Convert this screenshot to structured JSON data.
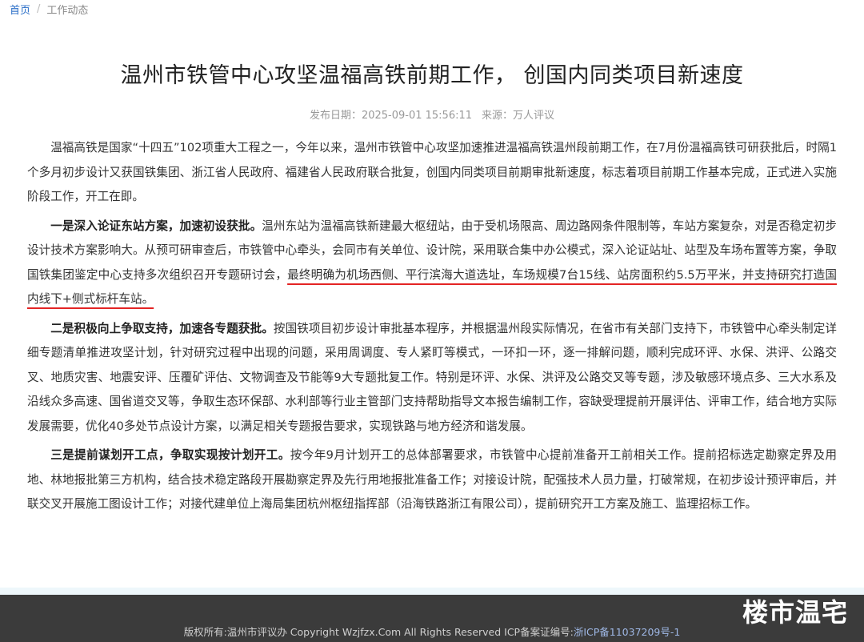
{
  "breadcrumb": {
    "home": "首页",
    "separator": "/",
    "current": "工作动态"
  },
  "article": {
    "title": "温州市铁管中心攻坚温福高铁前期工作， 创国内同类项目新速度",
    "publish_label": "发布日期：",
    "publish_date": "2025-09-01 15:56:11",
    "source_label": "来源：",
    "source": "万人评议",
    "paragraphs": [
      {
        "bold": "",
        "text": "温福高铁是国家“十四五”102项重大工程之一，今年以来，温州市铁管中心攻坚加速推进温福高铁温州段前期工作，在7月份温福高铁可研获批后，时隔1个多月初步设计又获国铁集团、浙江省人民政府、福建省人民政府联合批复，创国内同类项目前期审批新速度，标志着项目前期工作基本完成，正式进入实施阶段工作，开工在即。",
        "highlight": "",
        "after": ""
      },
      {
        "bold": "一是深入论证东站方案，加速初设获批。",
        "text": "温州东站为温福高铁新建最大枢纽站，由于受机场限高、周边路网条件限制等，车站方案复杂，对是否稳定初步设计技术方案影响大。从预可研审查后，市铁管中心牵头，会同市有关单位、设计院，采用联合集中办公模式，深入论证站址、站型及车场布置等方案，争取国铁集团鉴定中心支持多次组织召开专题研讨会，",
        "highlight": "最终明确为机场西侧、平行滨海大道选址，车场规模7台15线、站房面积约5.5万平米，并支持研究打造国内线下+侧式标杆车站。",
        "after": ""
      },
      {
        "bold": "二是积极向上争取支持，加速各专题获批。",
        "text": "按国铁项目初步设计审批基本程序，并根据温州段实际情况，在省市有关部门支持下，市铁管中心牵头制定详细专题清单推进攻坚计划，针对研究过程中出现的问题，采用周调度、专人紧盯等模式，一环扣一环，逐一排解问题，顺利完成环评、水保、洪评、公路交叉、地质灾害、地震安评、压覆矿评估、文物调查及节能等9大专题批复工作。特别是环评、水保、洪评及公路交叉等专题，涉及敏感环境点多、三大水系及沿线众多高速、国省道交叉等，争取生态环保部、水利部等行业主管部门支持帮助指导文本报告编制工作，容缺受理提前开展评估、评审工作，结合地方实际发展需要，优化40多处节点设计方案，以满足相关专题报告要求，实现铁路与地方经济和谐发展。",
        "highlight": "",
        "after": ""
      },
      {
        "bold": "三是提前谋划开工点，争取实现按计划开工。",
        "text": "按今年9月计划开工的总体部署要求，市铁管中心提前准备开工前相关工作。提前招标选定勘察定界及用地、林地报批第三方机构，结合技术稳定路段开展勘察定界及先行用地报批准备工作；对接设计院，配强技术人员力量，打破常规，在初步设计预评审后，并联交叉开展施工图设计工作；对接代建单位上海局集团杭州枢纽指挥部（沿海铁路浙江有限公司），提前研究开工方案及施工、监理招标工作。",
        "highlight": "",
        "after": ""
      }
    ]
  },
  "footer": {
    "copyright": "版权所有:温州市评议办  Copyright Wzjfzx.Com All Rights Reserved   ICP备案证编号:",
    "icp": "浙ICP备11037209号-1",
    "watermark": "楼市温宅"
  }
}
